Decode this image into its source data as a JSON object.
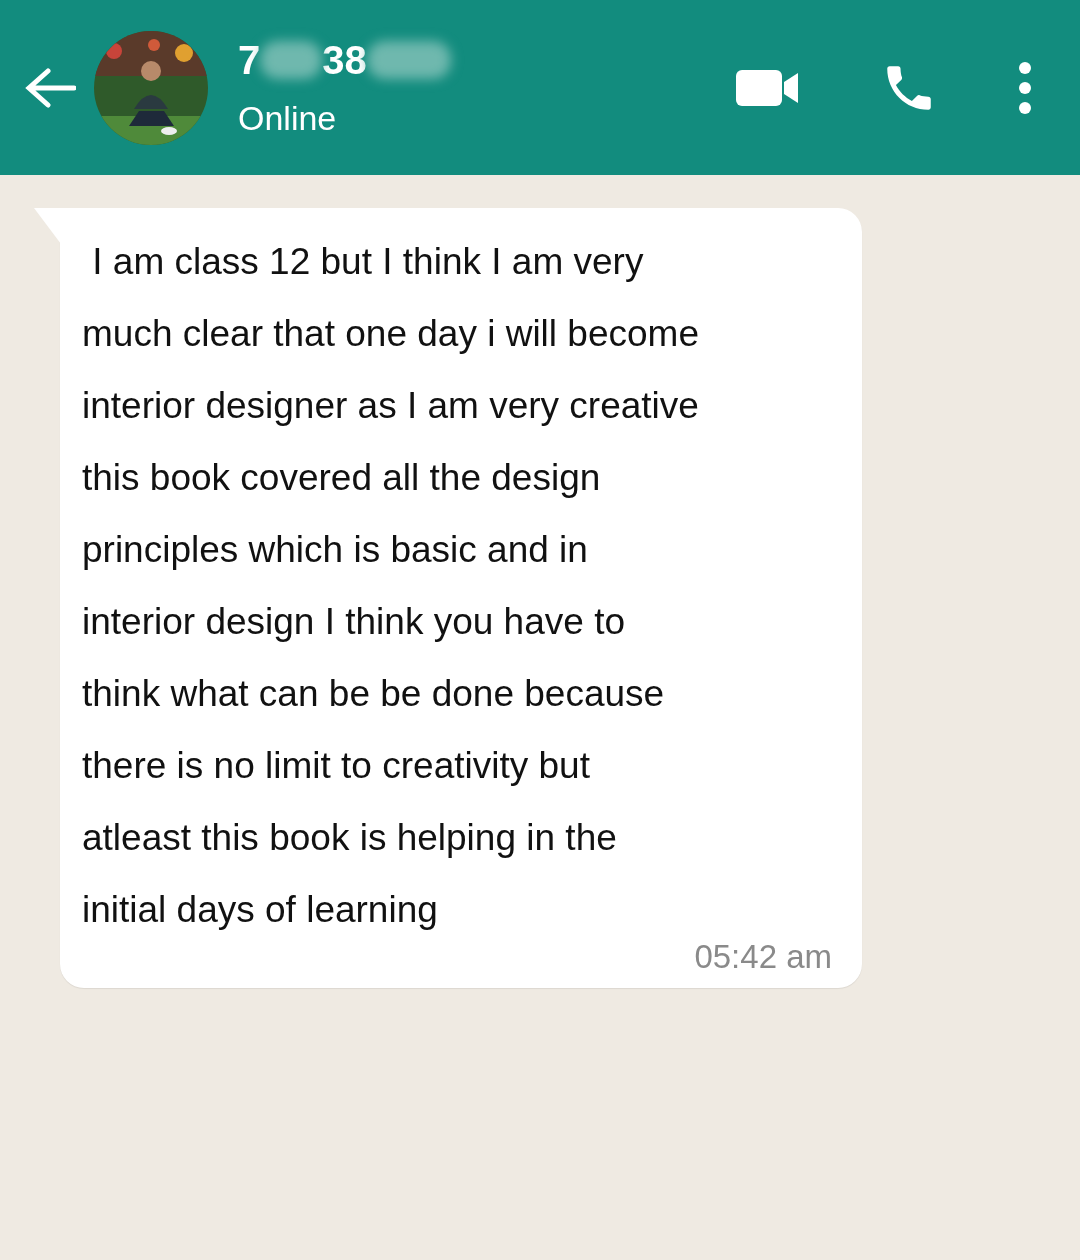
{
  "header": {
    "name_parts": [
      "7",
      "38"
    ],
    "status": "Online"
  },
  "messages": [
    {
      "kind": "incoming",
      "lines": [
        " I am class 12 but I think I am very",
        "much clear that one day i will become",
        "interior designer as I am very creative",
        "this book covered all the design",
        "principles which is basic and in",
        "interior design I think you have to",
        "think what can be be done because",
        "there is no limit to creativity but",
        "atleast this book is helping in the",
        "initial days of learning"
      ],
      "time": "05:42 am"
    }
  ]
}
